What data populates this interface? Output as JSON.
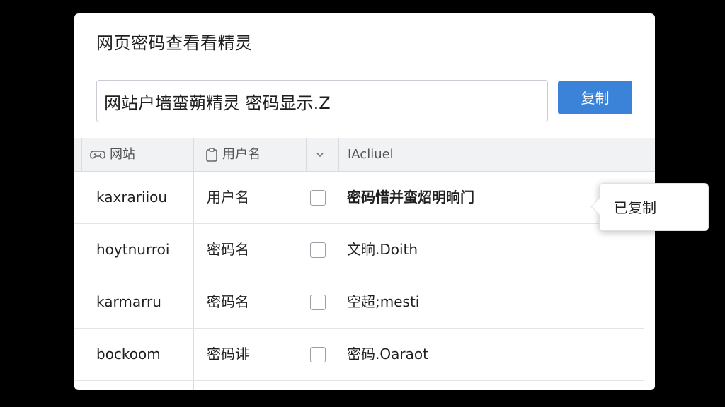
{
  "window": {
    "title": "网页密码查看看精灵"
  },
  "search": {
    "value": "网站户墙蛮蒴精灵 密码显示.Z"
  },
  "toolbar": {
    "copy_label": "复制"
  },
  "table": {
    "headers": {
      "site": "网站",
      "username": "用户名",
      "sort_icon": "chevron-down-icon",
      "password": "IAcliuel"
    },
    "rows": [
      {
        "site": "kaxrariiou",
        "username": "用户名",
        "password": "密码惜并蛮炤明晌门",
        "bold": true
      },
      {
        "site": "hoytnurroi",
        "username": "密码名",
        "password": "文晌.Doith",
        "bold": false
      },
      {
        "site": "karmarru",
        "username": "密码名",
        "password": "空超;mesti",
        "bold": false
      },
      {
        "site": "bockoom",
        "username": "密码诽",
        "password": "密码.Oaraot",
        "bold": false
      }
    ]
  },
  "toast": {
    "text": "已复制"
  },
  "colors": {
    "accent": "#3a83d8",
    "background": "#000000",
    "panel": "#ffffff",
    "header_bg": "#f1f2f4"
  }
}
